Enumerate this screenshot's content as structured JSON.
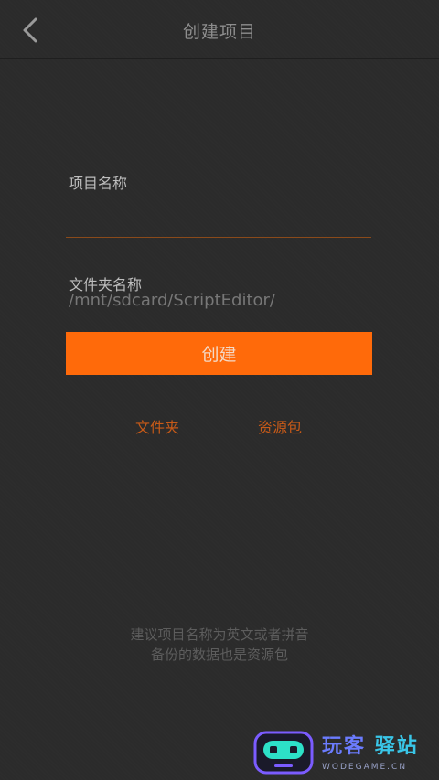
{
  "header": {
    "title": "创建项目",
    "back_icon": "chevron-left-icon"
  },
  "form": {
    "project_name_label": "项目名称",
    "project_name_value": "",
    "project_name_placeholder": "",
    "folder_name_label": "文件夹名称",
    "folder_path": "/mnt/sdcard/ScriptEditor/",
    "create_button": "创建"
  },
  "links": {
    "folder": "文件夹",
    "resource_pack": "资源包"
  },
  "hint": {
    "line1": "建议项目名称为英文或者拼音",
    "line2": "备份的数据也是资源包"
  },
  "watermark": {
    "text_a": "玩客",
    "text_b": "驿站",
    "url": "WODEGAME.CN"
  },
  "colors": {
    "accent": "#ff6a0a",
    "background": "#2b2b2b"
  }
}
